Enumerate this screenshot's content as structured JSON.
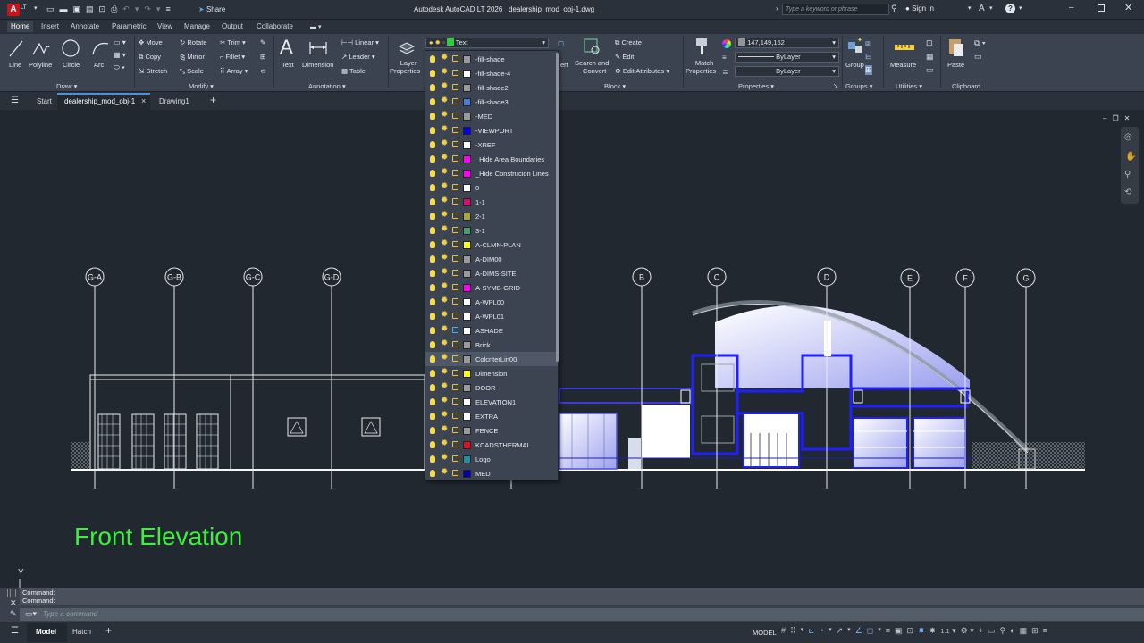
{
  "app": {
    "title": "Autodesk AutoCAD LT 2026",
    "filename": "dealership_mod_obj-1.dwg",
    "share_label": "Share",
    "search_placeholder": "Type a keyword or phrase",
    "signin_label": "Sign In",
    "app_letter": "A",
    "lt_badge": "LT"
  },
  "ribbon_tabs": [
    "Home",
    "Insert",
    "Annotate",
    "Parametric",
    "View",
    "Manage",
    "Output",
    "Collaborate"
  ],
  "draw": {
    "line": "Line",
    "polyline": "Polyline",
    "circle": "Circle",
    "arc": "Arc",
    "group": "Draw"
  },
  "modify": {
    "move": "Move",
    "rotate": "Rotate",
    "trim": "Trim",
    "copy": "Copy",
    "mirror": "Mirror",
    "fillet": "Fillet",
    "stretch": "Stretch",
    "scale": "Scale",
    "array": "Array",
    "group": "Modify"
  },
  "annotation": {
    "text": "Text",
    "dimension": "Dimension",
    "linear": "Linear",
    "leader": "Leader",
    "table": "Table",
    "group": "Annotation"
  },
  "layers": {
    "layer_properties_1": "Layer",
    "layer_properties_2": "Properties",
    "current_layer": "Text",
    "current_color": "#2ecc40",
    "insert_partial": "ert"
  },
  "block": {
    "create": "Create",
    "edit": "Edit",
    "edit_attributes": "Edit Attributes",
    "search_convert_1": "Search and",
    "search_convert_2": "Convert",
    "group": "Block"
  },
  "properties": {
    "match_1": "Match",
    "match_2": "Properties",
    "color_value": "147,149,152",
    "linetype": "ByLayer",
    "lineweight": "ByLayer",
    "group": "Properties"
  },
  "groups": {
    "label": "Group",
    "group": "Groups"
  },
  "utilities": {
    "measure": "Measure",
    "group": "Utilities"
  },
  "clipboard": {
    "paste": "Paste",
    "group": "Clipboard"
  },
  "file_tabs": {
    "start": "Start",
    "active": "dealership_mod_obj-1",
    "drawing1": "Drawing1"
  },
  "layer_list": [
    {
      "name": "-fill-shade",
      "color": "#9a9a9a"
    },
    {
      "name": "-fill-shade-4",
      "color": "#ffffff"
    },
    {
      "name": "-fill-shade2",
      "color": "#9a9a9a"
    },
    {
      "name": "-fill-shade3",
      "color": "#4a7fd6"
    },
    {
      "name": "-MED",
      "color": "#9a9a9a"
    },
    {
      "name": "-VIEWPORT",
      "color": "#0000ee"
    },
    {
      "name": "-XREF",
      "color": "#ffffff"
    },
    {
      "name": "_Hide Area Boundaries",
      "color": "#ff00ff"
    },
    {
      "name": "_Hide Construcion Lines",
      "color": "#ff00ff"
    },
    {
      "name": "0",
      "color": "#ffffff"
    },
    {
      "name": "1-1",
      "color": "#d40f6e"
    },
    {
      "name": "2-1",
      "color": "#a8a83a"
    },
    {
      "name": "3-1",
      "color": "#4a9a72"
    },
    {
      "name": "A-CLMN-PLAN",
      "color": "#ffff00"
    },
    {
      "name": "A-DIM00",
      "color": "#9a9a9a"
    },
    {
      "name": "A-DIMS-SITE",
      "color": "#9a9a9a"
    },
    {
      "name": "A-SYMB-GRID",
      "color": "#ff00ff"
    },
    {
      "name": "A-WPL00",
      "color": "#ffffff"
    },
    {
      "name": "A-WPL01",
      "color": "#ffffff"
    },
    {
      "name": "ASHADE",
      "color": "#ffffff"
    },
    {
      "name": "Brick",
      "color": "#9a9a9a"
    },
    {
      "name": "ColcnterLin00",
      "color": "#9a9a9a"
    },
    {
      "name": "Dimension",
      "color": "#ffff00"
    },
    {
      "name": "DOOR",
      "color": "#9a9a9a"
    },
    {
      "name": "ELEVATION1",
      "color": "#ffffff"
    },
    {
      "name": "EXTRA",
      "color": "#ffffff"
    },
    {
      "name": "FENCE",
      "color": "#9a9a9a"
    },
    {
      "name": "KCADSTHERMAL",
      "color": "#e01020"
    },
    {
      "name": "Logo",
      "color": "#1e90a8"
    },
    {
      "name": "MED",
      "color": "#0000aa"
    }
  ],
  "grid_bubbles": [
    "G-A",
    "G-B",
    "G-C",
    "G-D",
    "B",
    "C",
    "D",
    "E",
    "F",
    "G"
  ],
  "drawing_title": "Front Elevation",
  "command": {
    "line1": "Command:",
    "line2": "Command:",
    "placeholder": "Type a command"
  },
  "status": {
    "model_tab": "Model",
    "hatch_tab": "Hatch",
    "model_label": "MODEL",
    "scale": "1:1"
  },
  "axis_y": "Y"
}
